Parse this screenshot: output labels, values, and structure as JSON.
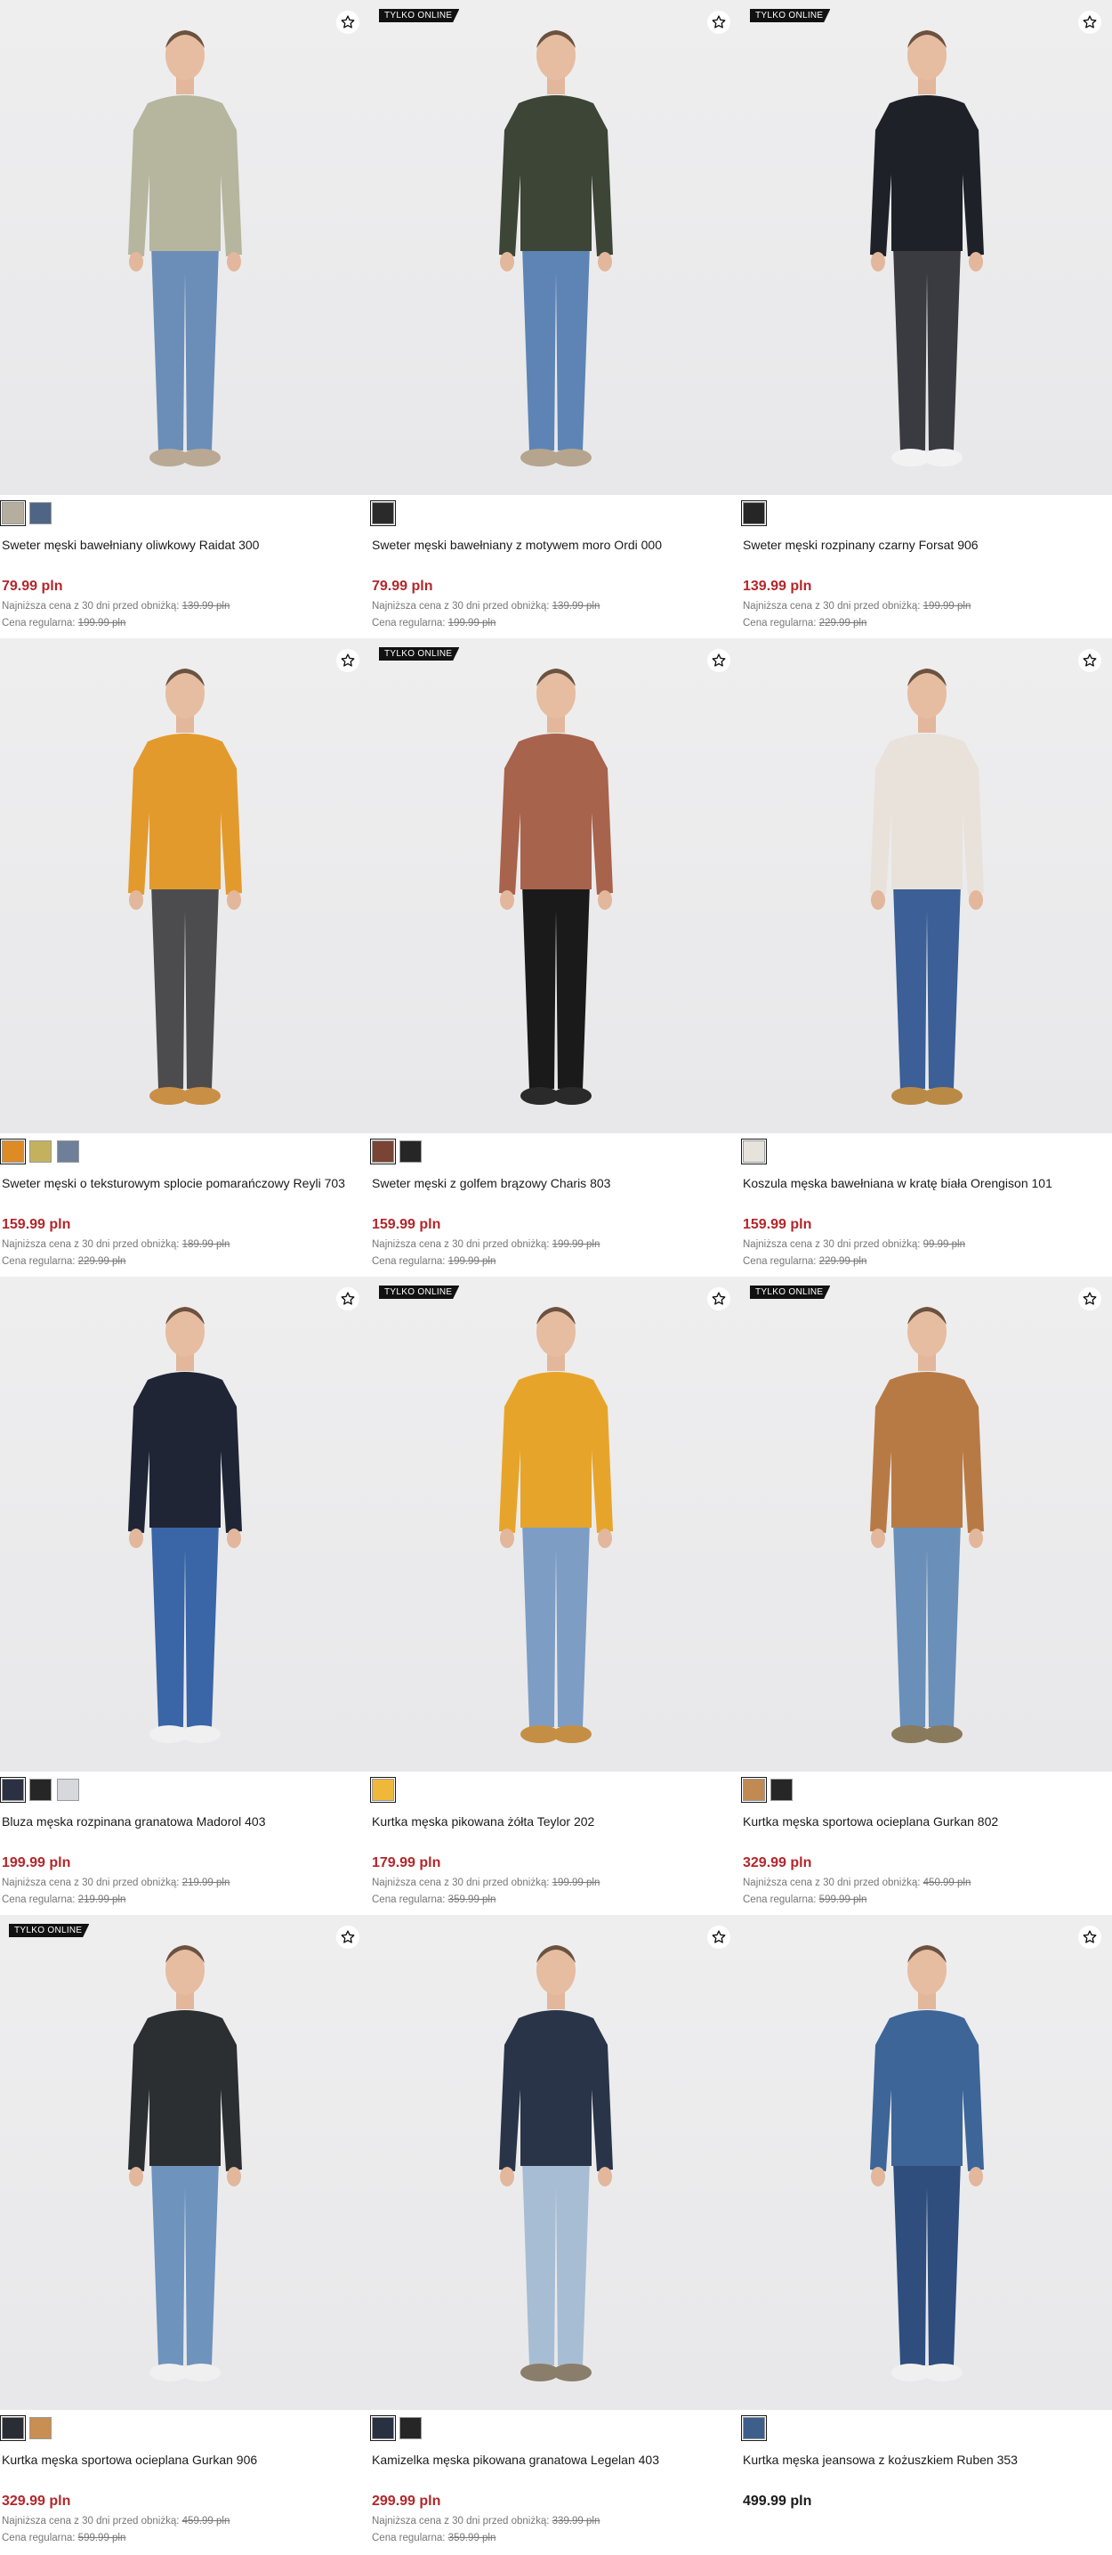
{
  "badge_text": "TYLKO ONLINE",
  "lowest_label": "Najniższa cena z 30 dni przed obniżką:",
  "regular_label": "Cena regularna:",
  "products": [
    {
      "name": "Sweter męski bawełniany oliwkowy Raidat 300",
      "price": "79.99 pln",
      "lowest": "139.99 pln",
      "regular": "199.99 pln",
      "online": false,
      "swatches": [
        "#b5ae9f",
        "#4e6585"
      ],
      "sel": 0,
      "top": "#b6b59e",
      "bottom": "#6b8eb8",
      "shoe": "#b9a994"
    },
    {
      "name": "Sweter męski bawełniany z motywem moro Ordi 000",
      "price": "79.99 pln",
      "lowest": "139.99 pln",
      "regular": "199.99 pln",
      "online": true,
      "swatches": [
        "#2a2a2a"
      ],
      "sel": 0,
      "top": "#3d4536",
      "bottom": "#5d84b5",
      "shoe": "#b5a58f"
    },
    {
      "name": "Sweter męski rozpinany czarny Forsat 906",
      "price": "139.99 pln",
      "lowest": "199.99 pln",
      "regular": "229.99 pln",
      "online": true,
      "swatches": [
        "#262626"
      ],
      "sel": 0,
      "top": "#1e2228",
      "bottom": "#3a3b40",
      "shoe": "#f2f2f2"
    },
    {
      "name": "Sweter męski o teksturowym splocie pomarańczowy Reyli 703",
      "price": "159.99 pln",
      "lowest": "189.99 pln",
      "regular": "229.99 pln",
      "online": false,
      "swatches": [
        "#de8b26",
        "#c4b15e",
        "#6f7f9a"
      ],
      "sel": 0,
      "top": "#e39a2c",
      "bottom": "#4c4c4f",
      "shoe": "#c98f45"
    },
    {
      "name": "Sweter męski z golfem brązowy Charis 803",
      "price": "159.99 pln",
      "lowest": "199.99 pln",
      "regular": "199.99 pln",
      "online": true,
      "swatches": [
        "#7a4434",
        "#262626"
      ],
      "sel": 0,
      "top": "#a8634c",
      "bottom": "#1a1a1a",
      "shoe": "#2a2a2a"
    },
    {
      "name": "Koszula męska bawełniana w kratę biała Orengison 101",
      "price": "159.99 pln",
      "lowest": "99.99 pln",
      "regular": "229.99 pln",
      "online": false,
      "swatches": [
        "#e6e2dc"
      ],
      "sel": 0,
      "top": "#e9e2db",
      "bottom": "#3b5f96",
      "shoe": "#b98a45"
    },
    {
      "name": "Bluza męska rozpinana granatowa Madorol 403",
      "price": "199.99 pln",
      "lowest": "219.99 pln",
      "regular": "219.99 pln",
      "online": false,
      "swatches": [
        "#2b3142",
        "#262626",
        "#d6d8dc"
      ],
      "sel": 0,
      "top": "#1f2535",
      "bottom": "#3a65a6",
      "shoe": "#f0f0f0"
    },
    {
      "name": "Kurtka męska pikowana żółta Teylor 202",
      "price": "179.99 pln",
      "lowest": "199.99 pln",
      "regular": "359.99 pln",
      "online": true,
      "swatches": [
        "#f0b83a"
      ],
      "sel": 0,
      "top": "#e6a52a",
      "bottom": "#7e9dc4",
      "shoe": "#c48f45"
    },
    {
      "name": "Kurtka męska sportowa ocieplana Gurkan 802",
      "price": "329.99 pln",
      "lowest": "450.99 pln",
      "regular": "599.99 pln",
      "online": true,
      "swatches": [
        "#c08a52",
        "#262626"
      ],
      "sel": 0,
      "top": "#b87a45",
      "bottom": "#6a8fb8",
      "shoe": "#8a7a5c"
    },
    {
      "name": "Kurtka męska sportowa ocieplana Gurkan 906",
      "price": "329.99 pln",
      "lowest": "459.99 pln",
      "regular": "599.99 pln",
      "online": true,
      "swatches": [
        "#2a2d33",
        "#c98e52"
      ],
      "sel": 0,
      "top": "#2b2f31",
      "bottom": "#6e93bd",
      "shoe": "#f0f0f0"
    },
    {
      "name": "Kamizelka męska pikowana granatowa Legelan 403",
      "price": "299.99 pln",
      "lowest": "339.99 pln",
      "regular": "359.99 pln",
      "online": false,
      "swatches": [
        "#283142",
        "#262626"
      ],
      "sel": 0,
      "top": "#2a3449",
      "bottom": "#a7bdd3",
      "shoe": "#8a7d6a"
    },
    {
      "name": "Kurtka męska jeansowa z kożuszkiem Ruben 353",
      "price": "499.99 pln",
      "lowest": "",
      "regular": "",
      "online": false,
      "swatches": [
        "#3e5f8c"
      ],
      "sel": 0,
      "top": "#3d6598",
      "bottom": "#2f4e7e",
      "shoe": "#f0f0f0"
    }
  ]
}
